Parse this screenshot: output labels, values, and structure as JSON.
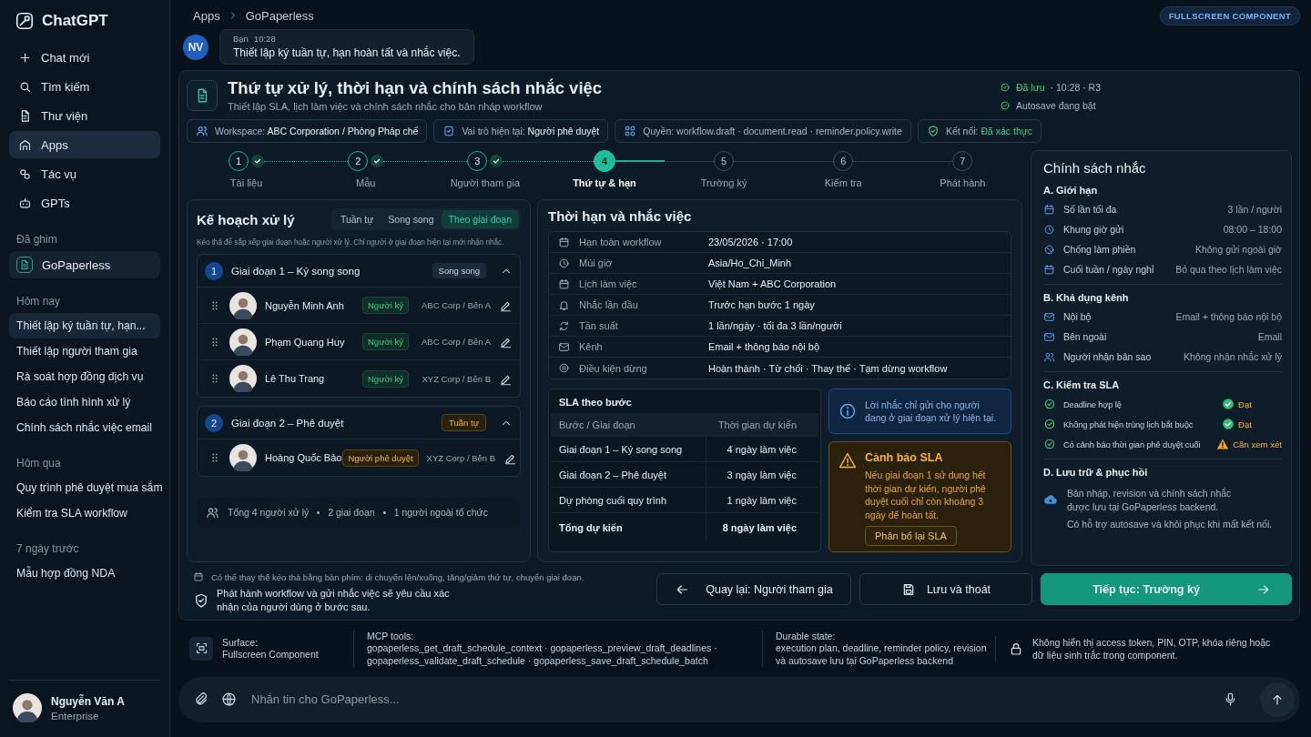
{
  "sidebar": {
    "brand": "ChatGPT",
    "nav": [
      {
        "label": "Chat mới",
        "selected": false
      },
      {
        "label": "Tìm kiếm",
        "selected": false
      },
      {
        "label": "Thư viện",
        "selected": false
      },
      {
        "label": "Apps",
        "selected": true
      },
      {
        "label": "Tác vụ",
        "selected": false
      },
      {
        "label": "GPTs",
        "selected": false
      }
    ],
    "pinned": {
      "heading": "Đã ghim",
      "items": [
        {
          "label": "GoPaperless"
        }
      ]
    },
    "history": [
      {
        "heading": "Hôm nay",
        "items": [
          {
            "label": "Thiết lập ký tuần tự, hạn...",
            "selected": true
          },
          {
            "label": "Thiết lập người tham gia",
            "selected": false
          },
          {
            "label": "Rà soát hợp đồng dịch vụ",
            "selected": false
          },
          {
            "label": "Báo cáo tình hình xử lý",
            "selected": false
          },
          {
            "label": "Chính sách nhắc việc email",
            "selected": false
          }
        ]
      },
      {
        "heading": "Hôm qua",
        "items": [
          {
            "label": "Quy trình phê duyệt mua sắm",
            "selected": false
          },
          {
            "label": "Kiểm tra SLA workflow",
            "selected": false
          }
        ]
      },
      {
        "heading": "7 ngày trước",
        "items": [
          {
            "label": "Mẫu hợp đồng NDA",
            "selected": false
          }
        ]
      }
    ],
    "user": {
      "name": "Nguyễn Văn A",
      "plan": "Enterprise"
    }
  },
  "breadcrumb": [
    "Apps",
    "GoPaperless"
  ],
  "badge": "FULLSCREEN COMPONENT",
  "message": {
    "initials": "NV",
    "author": "Bạn",
    "time": "10:28",
    "text": "Thiết lập ký tuần tự, hạn hoàn tất và nhắc việc."
  },
  "component": {
    "title": "Thứ tự xử lý, thời hạn và chính sách nhắc việc",
    "subtitle": "Thiết lập SLA, lịch làm việc và chính sách nhắc cho bản nháp workflow",
    "status": [
      {
        "highlight": "Đã lưu",
        "text": "· 10:28 · R3"
      },
      {
        "text": "Autosave đang bật"
      }
    ],
    "pills": [
      {
        "label": "Workspace:",
        "value": "ABC Corporation / Phòng Pháp chế",
        "kind": "strong"
      },
      {
        "label": "Vai trò hiện tại:",
        "value": "Người phê duyệt",
        "kind": "strong"
      },
      {
        "label": "Quyền:",
        "value": "workflow.draft · document.read · reminder.policy.write",
        "kind": "plain"
      },
      {
        "label": "Kết nối:",
        "value": "Đã xác thực",
        "kind": "success"
      }
    ],
    "steps": [
      {
        "number": "1",
        "label": "Tài liệu",
        "done": true,
        "selected": false
      },
      {
        "number": "2",
        "label": "Mẫu",
        "done": true,
        "selected": false
      },
      {
        "number": "3",
        "label": "Người tham gia",
        "done": true,
        "selected": false
      },
      {
        "number": "4",
        "label": "Thứ tự & hạn",
        "done": false,
        "selected": true
      },
      {
        "number": "5",
        "label": "Trường ký",
        "done": false,
        "selected": false
      },
      {
        "number": "6",
        "label": "Kiểm tra",
        "done": false,
        "selected": false
      },
      {
        "number": "7",
        "label": "Phát hành",
        "done": false,
        "selected": false
      }
    ],
    "plan": {
      "title": "Kế hoạch xử lý",
      "modes": [
        {
          "label": "Tuần tự",
          "selected": false
        },
        {
          "label": "Song song",
          "selected": false
        },
        {
          "label": "Theo giai đoạn",
          "selected": true
        }
      ],
      "hint": "Kéo thả để sắp xếp giai đoạn hoặc người xử lý. Chỉ người ở giai đoạn hiện tại mới nhận nhắc.",
      "stages": [
        {
          "number": "1",
          "title": "Giai đoạn 1 – Ký song song",
          "mode": "Song song",
          "kind": "parallel",
          "expanded": true,
          "people": [
            {
              "name": "Nguyễn Minh Anh",
              "role": "Người ký",
              "kind": "signer",
              "org": "ABC Corp / Bên A"
            },
            {
              "name": "Phạm Quang Huy",
              "role": "Người ký",
              "kind": "signer",
              "org": "ABC Corp / Bên A"
            },
            {
              "name": "Lê Thu Trang",
              "role": "Người ký",
              "kind": "signer",
              "org": "XYZ Corp / Bên B"
            }
          ]
        },
        {
          "number": "2",
          "title": "Giai đoạn 2 – Phê duyệt",
          "mode": "Tuần tự",
          "kind": "sequential",
          "expanded": true,
          "people": [
            {
              "name": "Hoàng Quốc Bảo",
              "role": "Người phê duyệt",
              "kind": "approver",
              "org": "XYZ Corp / Bên B"
            }
          ]
        }
      ],
      "summary": [
        "Tổng 4 người xử lý",
        "2 giai đoạn",
        "1 người ngoài tổ chức"
      ]
    },
    "deadlines": {
      "title": "Thời hạn và nhắc việc",
      "rows": [
        {
          "label": "Hạn toàn workflow",
          "value": "23/05/2026 · 17:00"
        },
        {
          "label": "Múi giờ",
          "value": "Asia/Ho_Chi_Minh"
        },
        {
          "label": "Lịch làm việc",
          "value": "Việt Nam + ABC Corporation"
        },
        {
          "label": "Nhắc lần đầu",
          "value": "Trước hạn bước 1 ngày"
        },
        {
          "label": "Tần suất",
          "value": "1 lần/ngày · tối đa 3 lần/người"
        },
        {
          "label": "Kênh",
          "value": "Email + thông báo nội bộ"
        },
        {
          "label": "Điều kiện dừng",
          "value": "Hoàn thành · Từ chối · Thay thế · Tạm dừng workflow"
        }
      ],
      "sla": {
        "title": "SLA theo bước",
        "columns": [
          "Bước / Giai đoạn",
          "Thời gian dự kiến"
        ],
        "rows": [
          {
            "step": "Giai đoạn 1 – Ký song song",
            "duration": "4 ngày làm việc",
            "total": false
          },
          {
            "step": "Giai đoạn 2 – Phê duyệt",
            "duration": "3 ngày làm việc",
            "total": false
          },
          {
            "step": "Dự phòng cuối quy trình",
            "duration": "1 ngày làm việc",
            "total": false
          },
          {
            "step": "Tổng dự kiến",
            "duration": "8 ngày làm việc",
            "total": true
          }
        ]
      },
      "info": "Lời nhắc chỉ gửi cho người đang ở giai đoạn xử lý hiện tại.",
      "warning": {
        "title": "Cảnh báo SLA",
        "text": "Nếu giai đoạn 1 sử dụng hết thời gian dự kiến, người phê duyệt cuối chỉ còn khoảng 3 ngày để hoàn tất.",
        "action": "Phân bổ lại SLA"
      }
    },
    "policy": {
      "title": "Chính sách nhắc",
      "sections": [
        {
          "heading": "A. Giới hạn",
          "kind": "settings",
          "rows": [
            {
              "label": "Số lần tối đa",
              "value": "3 lần / người"
            },
            {
              "label": "Khung giờ gửi",
              "value": "08:00 – 18:00"
            },
            {
              "label": "Chống làm phiền",
              "value": "Không gửi ngoài giờ"
            },
            {
              "label": "Cuối tuần / ngày nghỉ",
              "value": "Bỏ qua theo lịch làm việc"
            }
          ]
        },
        {
          "heading": "B. Khả dụng kênh",
          "kind": "channels",
          "rows": [
            {
              "label": "Nội bộ",
              "value": "Email + thông báo nội bộ"
            },
            {
              "label": "Bên ngoài",
              "value": "Email"
            },
            {
              "label": "Người nhận bản sao",
              "value": "Không nhận nhắc xử lý"
            }
          ]
        },
        {
          "heading": "C. Kiểm tra SLA",
          "kind": "checks",
          "rows": [
            {
              "label": "Deadline hợp lệ",
              "result": "Đạt",
              "kind": "pass"
            },
            {
              "label": "Không phát hiện trùng lịch bắt buộc",
              "result": "Đạt",
              "kind": "pass"
            },
            {
              "label": "Có cảnh báo thời gian phê duyệt cuối",
              "result": "Cần xem xét",
              "kind": "warn"
            }
          ]
        },
        {
          "heading": "D. Lưu trữ & phục hồi",
          "kind": "note",
          "lines": [
            "Bản nháp, revision và chính sách nhắc được lưu tại GoPaperless backend.",
            "Có hỗ trợ autosave và khôi phục khi mất kết nối."
          ]
        }
      ]
    },
    "keyboard_hint": "Có thể thay thế kéo thả bằng bàn phím: di chuyển lên/xuống, tăng/giảm thứ tự, chuyển giai đoạn.",
    "publish_note": "Phát hành workflow và gửi nhắc việc sẽ yêu cầu xác nhận của người dùng ở bước sau.",
    "buttons": [
      {
        "label": "Quay lại: Người tham gia",
        "kind": "back"
      },
      {
        "label": "Lưu và thoát",
        "kind": "save"
      },
      {
        "label": "Tiếp tục: Trường ký",
        "kind": "primary"
      }
    ]
  },
  "footer_info": [
    {
      "title": "Surface:",
      "text": "Fullscreen Component"
    },
    {
      "title": "MCP tools:",
      "text": "gopaperless_get_draft_schedule_context · gopaperless_preview_draft_deadlines · gopaperless_validate_draft_schedule · gopaperless_save_draft_schedule_batch"
    },
    {
      "title": "Durable state:",
      "text": "execution plan, deadline, reminder policy, revision và autosave lưu tại GoPaperless backend"
    },
    {
      "text": "Không hiển thị access token, PIN, OTP, khóa riêng hoặc dữ liệu sinh trắc trong component."
    }
  ],
  "composer": {
    "placeholder": "Nhắn tin cho GoPaperless..."
  }
}
